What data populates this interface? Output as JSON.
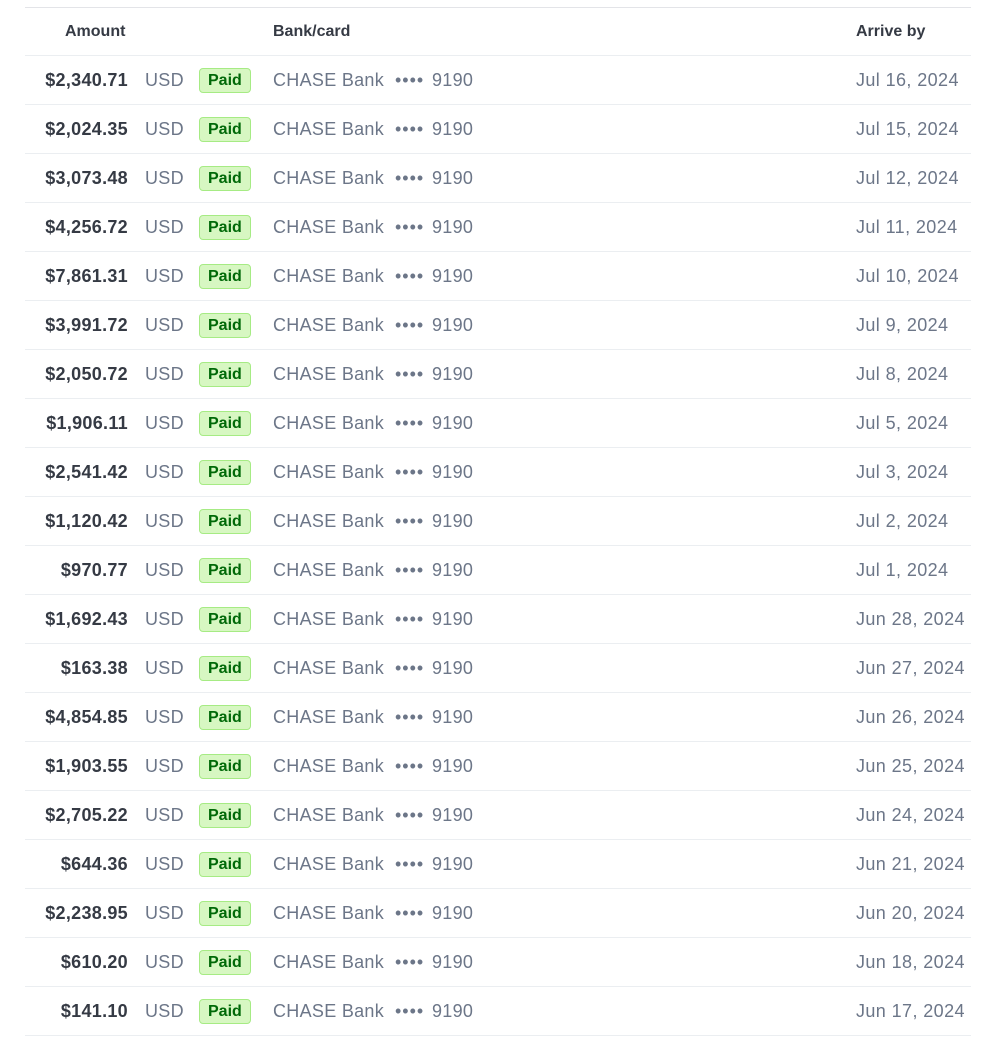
{
  "table": {
    "headers": {
      "amount": "Amount",
      "bank_card": "Bank/card",
      "arrive_by": "Arrive by"
    },
    "rows": [
      {
        "amount": "$2,340.71",
        "currency": "USD",
        "status": "Paid",
        "bank": "CHASE Bank",
        "mask": "••••",
        "last4": "9190",
        "arrive_by": "Jul 16, 2024"
      },
      {
        "amount": "$2,024.35",
        "currency": "USD",
        "status": "Paid",
        "bank": "CHASE Bank",
        "mask": "••••",
        "last4": "9190",
        "arrive_by": "Jul 15, 2024"
      },
      {
        "amount": "$3,073.48",
        "currency": "USD",
        "status": "Paid",
        "bank": "CHASE Bank",
        "mask": "••••",
        "last4": "9190",
        "arrive_by": "Jul 12, 2024"
      },
      {
        "amount": "$4,256.72",
        "currency": "USD",
        "status": "Paid",
        "bank": "CHASE Bank",
        "mask": "••••",
        "last4": "9190",
        "arrive_by": "Jul 11, 2024"
      },
      {
        "amount": "$7,861.31",
        "currency": "USD",
        "status": "Paid",
        "bank": "CHASE Bank",
        "mask": "••••",
        "last4": "9190",
        "arrive_by": "Jul 10, 2024"
      },
      {
        "amount": "$3,991.72",
        "currency": "USD",
        "status": "Paid",
        "bank": "CHASE Bank",
        "mask": "••••",
        "last4": "9190",
        "arrive_by": "Jul 9, 2024"
      },
      {
        "amount": "$2,050.72",
        "currency": "USD",
        "status": "Paid",
        "bank": "CHASE Bank",
        "mask": "••••",
        "last4": "9190",
        "arrive_by": "Jul 8, 2024"
      },
      {
        "amount": "$1,906.11",
        "currency": "USD",
        "status": "Paid",
        "bank": "CHASE Bank",
        "mask": "••••",
        "last4": "9190",
        "arrive_by": "Jul 5, 2024"
      },
      {
        "amount": "$2,541.42",
        "currency": "USD",
        "status": "Paid",
        "bank": "CHASE Bank",
        "mask": "••••",
        "last4": "9190",
        "arrive_by": "Jul 3, 2024"
      },
      {
        "amount": "$1,120.42",
        "currency": "USD",
        "status": "Paid",
        "bank": "CHASE Bank",
        "mask": "••••",
        "last4": "9190",
        "arrive_by": "Jul 2, 2024"
      },
      {
        "amount": "$970.77",
        "currency": "USD",
        "status": "Paid",
        "bank": "CHASE Bank",
        "mask": "••••",
        "last4": "9190",
        "arrive_by": "Jul 1, 2024"
      },
      {
        "amount": "$1,692.43",
        "currency": "USD",
        "status": "Paid",
        "bank": "CHASE Bank",
        "mask": "••••",
        "last4": "9190",
        "arrive_by": "Jun 28, 2024"
      },
      {
        "amount": "$163.38",
        "currency": "USD",
        "status": "Paid",
        "bank": "CHASE Bank",
        "mask": "••••",
        "last4": "9190",
        "arrive_by": "Jun 27, 2024"
      },
      {
        "amount": "$4,854.85",
        "currency": "USD",
        "status": "Paid",
        "bank": "CHASE Bank",
        "mask": "••••",
        "last4": "9190",
        "arrive_by": "Jun 26, 2024"
      },
      {
        "amount": "$1,903.55",
        "currency": "USD",
        "status": "Paid",
        "bank": "CHASE Bank",
        "mask": "••••",
        "last4": "9190",
        "arrive_by": "Jun 25, 2024"
      },
      {
        "amount": "$2,705.22",
        "currency": "USD",
        "status": "Paid",
        "bank": "CHASE Bank",
        "mask": "••••",
        "last4": "9190",
        "arrive_by": "Jun 24, 2024"
      },
      {
        "amount": "$644.36",
        "currency": "USD",
        "status": "Paid",
        "bank": "CHASE Bank",
        "mask": "••••",
        "last4": "9190",
        "arrive_by": "Jun 21, 2024"
      },
      {
        "amount": "$2,238.95",
        "currency": "USD",
        "status": "Paid",
        "bank": "CHASE Bank",
        "mask": "••••",
        "last4": "9190",
        "arrive_by": "Jun 20, 2024"
      },
      {
        "amount": "$610.20",
        "currency": "USD",
        "status": "Paid",
        "bank": "CHASE Bank",
        "mask": "••••",
        "last4": "9190",
        "arrive_by": "Jun 18, 2024"
      },
      {
        "amount": "$141.10",
        "currency": "USD",
        "status": "Paid",
        "bank": "CHASE Bank",
        "mask": "••••",
        "last4": "9190",
        "arrive_by": "Jun 17, 2024"
      }
    ]
  },
  "colors": {
    "paid_badge_bg": "#d7f7c2",
    "paid_badge_text": "#006908",
    "paid_badge_border": "#a6eb84"
  }
}
